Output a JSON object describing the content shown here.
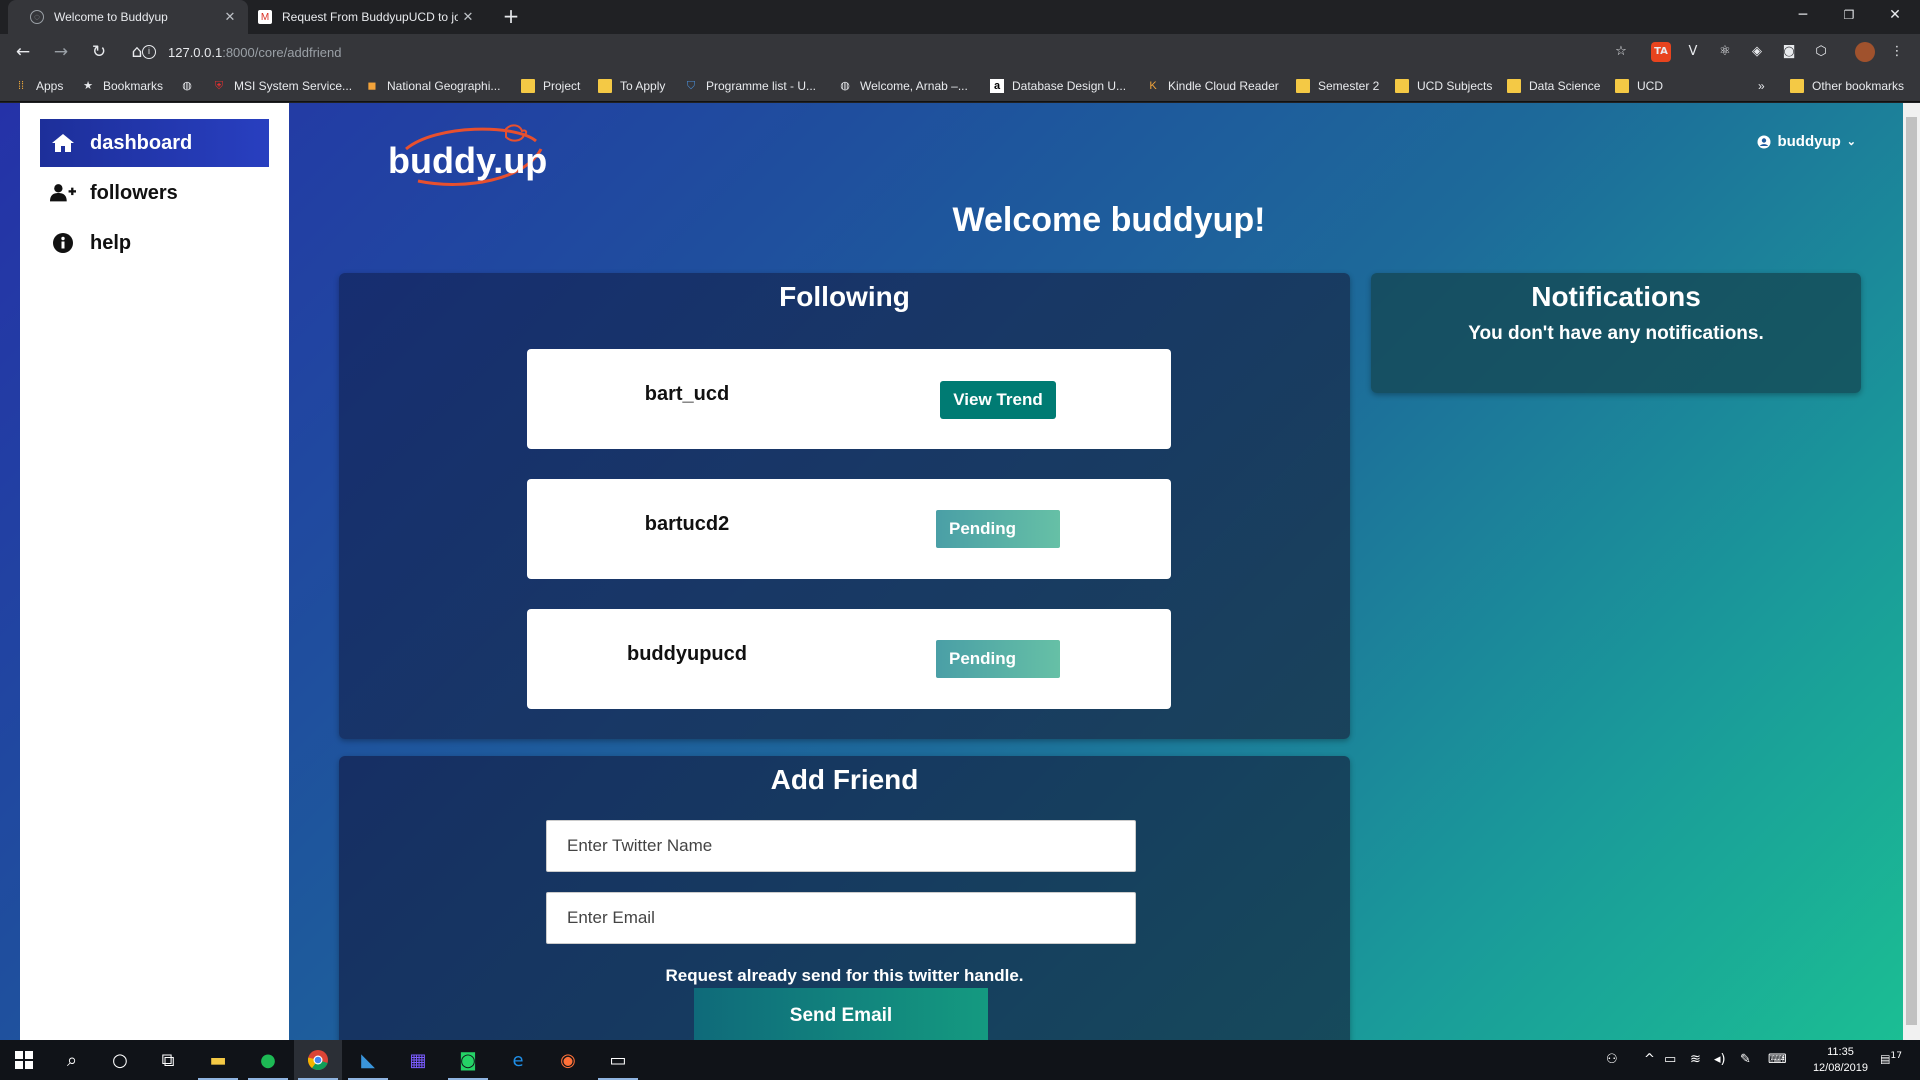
{
  "browser": {
    "tabs": [
      {
        "title": "Welcome to Buddyup",
        "active": true
      },
      {
        "title": "Request From BuddyupUCD to jo",
        "active": false
      }
    ],
    "url_host": "127.0.0.1",
    "url_path": ":8000/core/addfriend"
  },
  "bookmarks": [
    {
      "label": "Apps",
      "icon": "apps-grid-icon"
    },
    {
      "label": "Bookmarks",
      "icon": "star-icon"
    },
    {
      "label": "",
      "icon": "globe-icon"
    },
    {
      "label": "MSI System Service...",
      "icon": "msi-shield-icon"
    },
    {
      "label": "National Geographi...",
      "icon": "natgeo-icon"
    },
    {
      "label": "Project",
      "icon": "folder-icon"
    },
    {
      "label": "To Apply",
      "icon": "folder-icon"
    },
    {
      "label": "Programme list - U...",
      "icon": "ucd-crest-icon"
    },
    {
      "label": "Welcome, Arnab –...",
      "icon": "globe-icon"
    },
    {
      "label": "Database Design U...",
      "icon": "amazon-icon"
    },
    {
      "label": "Kindle Cloud Reader",
      "icon": "kindle-icon"
    },
    {
      "label": "Semester 2",
      "icon": "folder-icon"
    },
    {
      "label": "UCD Subjects",
      "icon": "folder-icon"
    },
    {
      "label": "Data Science",
      "icon": "folder-icon"
    },
    {
      "label": "UCD",
      "icon": "folder-icon"
    },
    {
      "label": "»",
      "icon": ""
    },
    {
      "label": "Other bookmarks",
      "icon": "folder-icon"
    }
  ],
  "sidebar": {
    "items": [
      {
        "label": "dashboard",
        "icon": "home-icon",
        "active": true
      },
      {
        "label": "followers",
        "icon": "add-user-icon",
        "active": false
      },
      {
        "label": "help",
        "icon": "info-icon",
        "active": false
      }
    ]
  },
  "header": {
    "logo_text": "buddy.up",
    "username": "buddyup"
  },
  "main": {
    "welcome": "Welcome buddyup!",
    "following": {
      "title": "Following",
      "items": [
        {
          "name": "bart_ucd",
          "action": "View Trend"
        },
        {
          "name": "bartucd2",
          "action": "Pending"
        },
        {
          "name": "buddyupucd",
          "action": "Pending"
        }
      ]
    },
    "notifications": {
      "title": "Notifications",
      "message": "You don't have any notifications."
    },
    "add_friend": {
      "title": "Add Friend",
      "twitter_placeholder": "Enter Twitter Name",
      "email_placeholder": "Enter Email",
      "message": "Request already send for this twitter handle.",
      "send_label": "Send Email"
    }
  },
  "taskbar": {
    "time": "11:35",
    "date": "12/08/2019",
    "notification_count": "17"
  },
  "colors": {
    "sidebar_active": "#2335b0",
    "view_trend_button": "#007b73",
    "pending_button": "#58b0a6",
    "gradient_start": "#2532a8",
    "gradient_end": "#1bbf93"
  }
}
